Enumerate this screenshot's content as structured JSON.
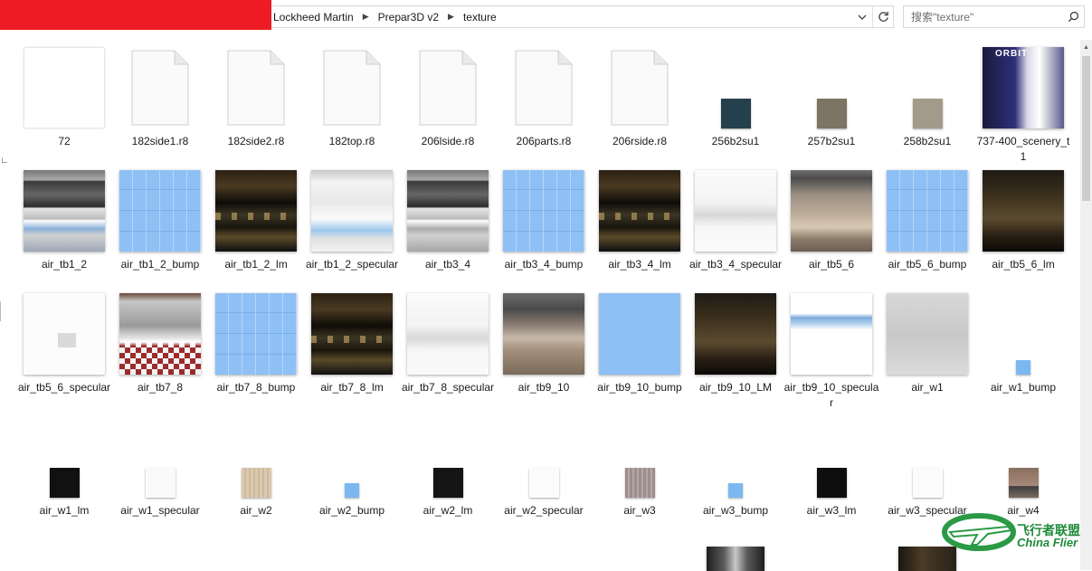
{
  "address": {
    "crumbs": [
      "Lockheed Martin",
      "Prepar3D v2",
      "texture"
    ],
    "dropdown_icon": "chevron-down-icon",
    "refresh_icon": "refresh-icon"
  },
  "search": {
    "placeholder": "搜索\"texture\"",
    "icon": "search-icon"
  },
  "files": [
    {
      "name": "72"
    },
    {
      "name": "182side1.r8"
    },
    {
      "name": "182side2.r8"
    },
    {
      "name": "182top.r8"
    },
    {
      "name": "206lside.r8"
    },
    {
      "name": "206parts.r8"
    },
    {
      "name": "206rside.r8"
    },
    {
      "name": "256b2su1"
    },
    {
      "name": "257b2su1"
    },
    {
      "name": "258b2su1"
    },
    {
      "name": "737-400_scenery_t1"
    },
    {
      "name": "air_tb1_2"
    },
    {
      "name": "air_tb1_2_bump"
    },
    {
      "name": "air_tb1_2_lm"
    },
    {
      "name": "air_tb1_2_specular"
    },
    {
      "name": "air_tb3_4"
    },
    {
      "name": "air_tb3_4_bump"
    },
    {
      "name": "air_tb3_4_lm"
    },
    {
      "name": "air_tb3_4_specular"
    },
    {
      "name": "air_tb5_6"
    },
    {
      "name": "air_tb5_6_bump"
    },
    {
      "name": "air_tb5_6_lm"
    },
    {
      "name": "air_tb5_6_specular"
    },
    {
      "name": "air_tb7_8"
    },
    {
      "name": "air_tb7_8_bump"
    },
    {
      "name": "air_tb7_8_lm"
    },
    {
      "name": "air_tb7_8_specular"
    },
    {
      "name": "air_tb9_10"
    },
    {
      "name": "air_tb9_10_bump"
    },
    {
      "name": "air_tb9_10_LM"
    },
    {
      "name": "air_tb9_10_specular"
    },
    {
      "name": "air_w1"
    },
    {
      "name": "air_w1_bump"
    },
    {
      "name": "air_w1_lm"
    },
    {
      "name": "air_w1_specular"
    },
    {
      "name": "air_w2"
    },
    {
      "name": "air_w2_bump"
    },
    {
      "name": "air_w2_lm"
    },
    {
      "name": "air_w2_specular"
    },
    {
      "name": "air_w3"
    },
    {
      "name": "air_w3_bump"
    },
    {
      "name": "air_w3_lm"
    },
    {
      "name": "air_w3_specular"
    },
    {
      "name": "air_w4"
    }
  ],
  "watermark": {
    "cn": "飞行者联盟",
    "en": "China Flier"
  },
  "colors": {
    "red_block": "#ed1c24",
    "bump_blue": "#8ec0f5",
    "watermark_green": "#1f8a3a"
  }
}
